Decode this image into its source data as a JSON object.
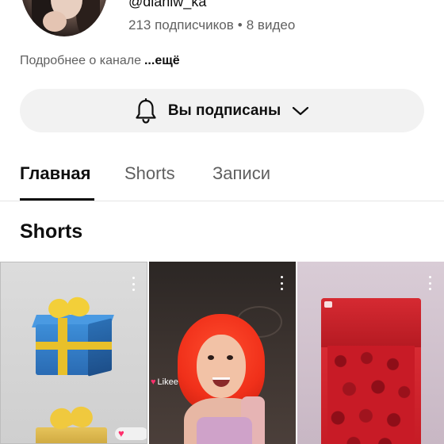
{
  "channel": {
    "handle": "@dianiw_ka",
    "subscribers": "213 подписчиков",
    "separator": "•",
    "videos": "8 видео",
    "about": "Подробнее о канале",
    "about_more": "...ещё"
  },
  "subscribe_button": {
    "label": "Вы подписаны",
    "bell_icon": "bell-icon",
    "chevron_icon": "chevron-down-icon"
  },
  "tabs": [
    {
      "label": "Главная",
      "active": true
    },
    {
      "label": "Shorts",
      "active": false
    },
    {
      "label": "Записи",
      "active": false
    }
  ],
  "section": {
    "title": "Shorts"
  },
  "shorts": [
    {
      "thumbnail": "gift-boxes",
      "menu_icon": "more-vert-icon"
    },
    {
      "thumbnail": "red-haired-girl",
      "overlay_text": "Likee",
      "menu_icon": "more-vert-icon"
    },
    {
      "thumbnail": "rose-bouquet",
      "menu_icon": "more-vert-icon"
    }
  ],
  "colors": {
    "text_primary": "#0f0f0f",
    "text_secondary": "#606060",
    "button_bg": "#f2f2f2",
    "likee_heart": "#ff2f6c"
  }
}
